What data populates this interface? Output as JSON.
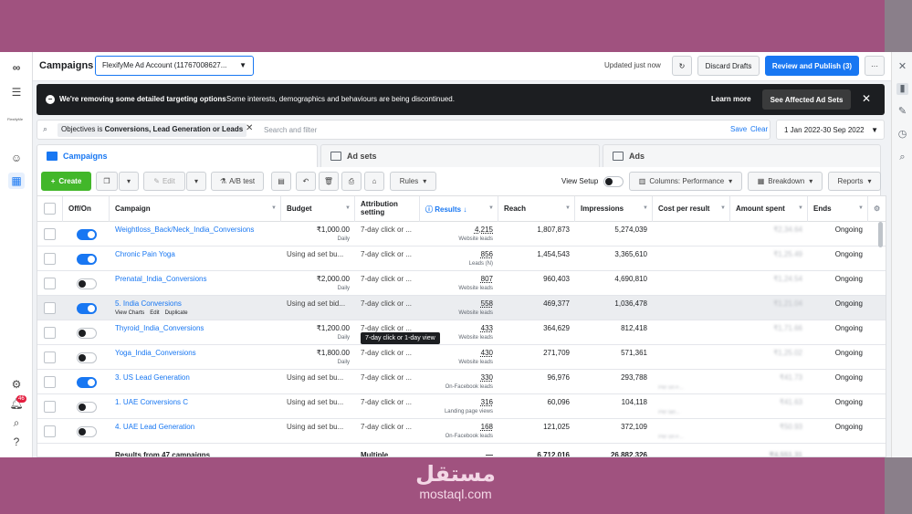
{
  "app": {
    "title": "Campaigns",
    "brand_mini": "FlexifyMe"
  },
  "account": {
    "label": "FlexifyMe Ad Account (11767008627..."
  },
  "status": {
    "updated": "Updated just now"
  },
  "actions": {
    "discard": "Discard Drafts",
    "review": "Review and Publish (3)",
    "more": "···"
  },
  "banner": {
    "title": "We're removing some detailed targeting options",
    "text": "Some interests, demographics and behaviours are being discontinued.",
    "learn": "Learn more",
    "affected": "See Affected Ad Sets"
  },
  "filter": {
    "chip_prefix": "Objectives is ",
    "chip_value": "Conversions, Lead Generation or Leads",
    "placeholder": "Search and filter",
    "save": "Save",
    "clear": "Clear",
    "date_range": "1 Jan 2022-30 Sep 2022"
  },
  "tabs": [
    "Campaigns",
    "Ad sets",
    "Ads"
  ],
  "toolbar": {
    "create": "Create",
    "edit": "Edit",
    "ab_test": "A/B test",
    "rules": "Rules",
    "view_setup": "View Setup",
    "columns": "Columns: Performance",
    "breakdown": "Breakdown",
    "reports": "Reports"
  },
  "columns": {
    "onoff": "Off/On",
    "campaign": "Campaign",
    "budget": "Budget",
    "attribution": "Attribution setting",
    "results": "Results",
    "reach": "Reach",
    "impressions": "Impressions",
    "cpr": "Cost per result",
    "spent": "Amount spent",
    "ends": "Ends"
  },
  "rows": [
    {
      "on": true,
      "name": "Weightloss_Back/Neck_India_Conversions",
      "budget": "₹1,000.00",
      "budget_sub": "Daily",
      "attr": "7-day click or ...",
      "result": "4,215",
      "result_sub": "Website leads",
      "reach": "1,807,873",
      "impr": "5,274,039",
      "cpr": "",
      "spent": "₹2,34.64",
      "ends": "Ongoing"
    },
    {
      "on": true,
      "name": "Chronic Pain Yoga",
      "budget": "Using ad set bu...",
      "budget_sub": "",
      "attr": "7-day click or ...",
      "result": "856",
      "result_sub": "Leads (N)",
      "reach": "1,454,543",
      "impr": "3,365,610",
      "cpr": "",
      "spent": "₹1,25.49",
      "ends": "Ongoing"
    },
    {
      "on": false,
      "name": "Prenatal_India_Conversions",
      "budget": "₹2,000.00",
      "budget_sub": "Daily",
      "attr": "7-day click or ...",
      "result": "807",
      "result_sub": "Website leads",
      "reach": "960,403",
      "impr": "4,690,810",
      "cpr": "",
      "spent": "₹1,24.54",
      "ends": "Ongoing"
    },
    {
      "on": true,
      "name": "5. India Conversions",
      "budget": "Using ad set bid...",
      "budget_sub": "",
      "attr": "7-day click or ...",
      "result": "558",
      "result_sub": "Website leads",
      "reach": "469,377",
      "impr": "1,036,478",
      "cpr": "",
      "spent": "₹1,21.04",
      "ends": "Ongoing"
    },
    {
      "on": false,
      "name": "Thyroid_India_Conversions",
      "budget": "₹1,200.00",
      "budget_sub": "Daily",
      "attr": "7-day click or ...",
      "result": "433",
      "result_sub": "Website leads",
      "reach": "364,629",
      "impr": "812,418",
      "cpr": "",
      "spent": "₹1,71.66",
      "ends": "Ongoing"
    },
    {
      "on": false,
      "name": "Yoga_India_Conversions",
      "budget": "₹1,800.00",
      "budget_sub": "Daily",
      "attr": "7-day click or ...",
      "result": "430",
      "result_sub": "Website leads",
      "reach": "271,709",
      "impr": "571,361",
      "cpr": "",
      "spent": "₹1,25.02",
      "ends": "Ongoing"
    },
    {
      "on": true,
      "name": "3. US Lead Generation",
      "budget": "Using ad set bu...",
      "budget_sub": "",
      "attr": "7-day click or ...",
      "result": "330",
      "result_sub": "On-Facebook leads",
      "reach": "96,976",
      "impr": "293,788",
      "cpr": "Per on-F...",
      "spent": "₹41.73",
      "ends": "Ongoing"
    },
    {
      "on": false,
      "name": "1. UAE Conversions C",
      "budget": "Using ad set bu...",
      "budget_sub": "",
      "attr": "7-day click or ...",
      "result": "316",
      "result_sub": "Landing page views",
      "reach": "60,096",
      "impr": "104,118",
      "cpr": "Per lan...",
      "spent": "₹41.63",
      "ends": "Ongoing"
    },
    {
      "on": false,
      "name": "4. UAE Lead Generation",
      "budget": "Using ad set bu...",
      "budget_sub": "",
      "attr": "7-day click or ...",
      "result": "168",
      "result_sub": "On-Facebook leads",
      "reach": "121,025",
      "impr": "372,109",
      "cpr": "Per on-F...",
      "spent": "₹50.93",
      "ends": "Ongoing"
    }
  ],
  "row_actions": {
    "charts": "View Charts",
    "edit": "Edit",
    "duplicate": "Duplicate"
  },
  "tooltip": "7-day click or 1-day view",
  "footer": {
    "label": "Results from 47 campaigns",
    "attr": "Multiple attrib...",
    "result": "—",
    "reach": "6,712,016",
    "impr": "26,882,326",
    "spent": "₹4,551.31"
  },
  "watermark": {
    "arabic": "مستقل",
    "domain": "mostaql.com"
  },
  "colors": {
    "accent": "#1877f2",
    "create": "#42b72a",
    "banner": "#1c1e21",
    "outer": "#a0527f"
  }
}
